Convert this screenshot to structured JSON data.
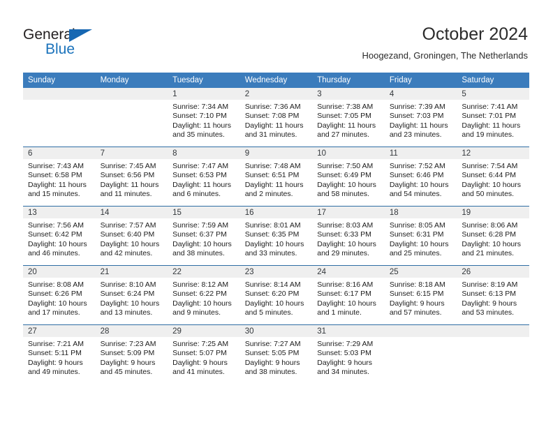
{
  "brand": {
    "name_part1": "General",
    "name_part2": "Blue",
    "triangle_color": "#1667b2",
    "blue_color": "#1a72bb"
  },
  "header": {
    "title": "October 2024",
    "subtitle": "Hoogezand, Groningen, The Netherlands"
  },
  "theme": {
    "header_row_bg": "#3b7cbc",
    "row_divider": "#2e6da4",
    "daynum_bg": "#efefef"
  },
  "weekdays": [
    "Sunday",
    "Monday",
    "Tuesday",
    "Wednesday",
    "Thursday",
    "Friday",
    "Saturday"
  ],
  "weeks": [
    [
      {
        "day": "",
        "empty": true,
        "sunrise": "",
        "sunset": "",
        "daylight_line1": "",
        "daylight_line2": ""
      },
      {
        "day": "",
        "empty": true,
        "sunrise": "",
        "sunset": "",
        "daylight_line1": "",
        "daylight_line2": ""
      },
      {
        "day": "1",
        "sunrise": "Sunrise: 7:34 AM",
        "sunset": "Sunset: 7:10 PM",
        "daylight_line1": "Daylight: 11 hours",
        "daylight_line2": "and 35 minutes."
      },
      {
        "day": "2",
        "sunrise": "Sunrise: 7:36 AM",
        "sunset": "Sunset: 7:08 PM",
        "daylight_line1": "Daylight: 11 hours",
        "daylight_line2": "and 31 minutes."
      },
      {
        "day": "3",
        "sunrise": "Sunrise: 7:38 AM",
        "sunset": "Sunset: 7:05 PM",
        "daylight_line1": "Daylight: 11 hours",
        "daylight_line2": "and 27 minutes."
      },
      {
        "day": "4",
        "sunrise": "Sunrise: 7:39 AM",
        "sunset": "Sunset: 7:03 PM",
        "daylight_line1": "Daylight: 11 hours",
        "daylight_line2": "and 23 minutes."
      },
      {
        "day": "5",
        "sunrise": "Sunrise: 7:41 AM",
        "sunset": "Sunset: 7:01 PM",
        "daylight_line1": "Daylight: 11 hours",
        "daylight_line2": "and 19 minutes."
      }
    ],
    [
      {
        "day": "6",
        "sunrise": "Sunrise: 7:43 AM",
        "sunset": "Sunset: 6:58 PM",
        "daylight_line1": "Daylight: 11 hours",
        "daylight_line2": "and 15 minutes."
      },
      {
        "day": "7",
        "sunrise": "Sunrise: 7:45 AM",
        "sunset": "Sunset: 6:56 PM",
        "daylight_line1": "Daylight: 11 hours",
        "daylight_line2": "and 11 minutes."
      },
      {
        "day": "8",
        "sunrise": "Sunrise: 7:47 AM",
        "sunset": "Sunset: 6:53 PM",
        "daylight_line1": "Daylight: 11 hours",
        "daylight_line2": "and 6 minutes."
      },
      {
        "day": "9",
        "sunrise": "Sunrise: 7:48 AM",
        "sunset": "Sunset: 6:51 PM",
        "daylight_line1": "Daylight: 11 hours",
        "daylight_line2": "and 2 minutes."
      },
      {
        "day": "10",
        "sunrise": "Sunrise: 7:50 AM",
        "sunset": "Sunset: 6:49 PM",
        "daylight_line1": "Daylight: 10 hours",
        "daylight_line2": "and 58 minutes."
      },
      {
        "day": "11",
        "sunrise": "Sunrise: 7:52 AM",
        "sunset": "Sunset: 6:46 PM",
        "daylight_line1": "Daylight: 10 hours",
        "daylight_line2": "and 54 minutes."
      },
      {
        "day": "12",
        "sunrise": "Sunrise: 7:54 AM",
        "sunset": "Sunset: 6:44 PM",
        "daylight_line1": "Daylight: 10 hours",
        "daylight_line2": "and 50 minutes."
      }
    ],
    [
      {
        "day": "13",
        "sunrise": "Sunrise: 7:56 AM",
        "sunset": "Sunset: 6:42 PM",
        "daylight_line1": "Daylight: 10 hours",
        "daylight_line2": "and 46 minutes."
      },
      {
        "day": "14",
        "sunrise": "Sunrise: 7:57 AM",
        "sunset": "Sunset: 6:40 PM",
        "daylight_line1": "Daylight: 10 hours",
        "daylight_line2": "and 42 minutes."
      },
      {
        "day": "15",
        "sunrise": "Sunrise: 7:59 AM",
        "sunset": "Sunset: 6:37 PM",
        "daylight_line1": "Daylight: 10 hours",
        "daylight_line2": "and 38 minutes."
      },
      {
        "day": "16",
        "sunrise": "Sunrise: 8:01 AM",
        "sunset": "Sunset: 6:35 PM",
        "daylight_line1": "Daylight: 10 hours",
        "daylight_line2": "and 33 minutes."
      },
      {
        "day": "17",
        "sunrise": "Sunrise: 8:03 AM",
        "sunset": "Sunset: 6:33 PM",
        "daylight_line1": "Daylight: 10 hours",
        "daylight_line2": "and 29 minutes."
      },
      {
        "day": "18",
        "sunrise": "Sunrise: 8:05 AM",
        "sunset": "Sunset: 6:31 PM",
        "daylight_line1": "Daylight: 10 hours",
        "daylight_line2": "and 25 minutes."
      },
      {
        "day": "19",
        "sunrise": "Sunrise: 8:06 AM",
        "sunset": "Sunset: 6:28 PM",
        "daylight_line1": "Daylight: 10 hours",
        "daylight_line2": "and 21 minutes."
      }
    ],
    [
      {
        "day": "20",
        "sunrise": "Sunrise: 8:08 AM",
        "sunset": "Sunset: 6:26 PM",
        "daylight_line1": "Daylight: 10 hours",
        "daylight_line2": "and 17 minutes."
      },
      {
        "day": "21",
        "sunrise": "Sunrise: 8:10 AM",
        "sunset": "Sunset: 6:24 PM",
        "daylight_line1": "Daylight: 10 hours",
        "daylight_line2": "and 13 minutes."
      },
      {
        "day": "22",
        "sunrise": "Sunrise: 8:12 AM",
        "sunset": "Sunset: 6:22 PM",
        "daylight_line1": "Daylight: 10 hours",
        "daylight_line2": "and 9 minutes."
      },
      {
        "day": "23",
        "sunrise": "Sunrise: 8:14 AM",
        "sunset": "Sunset: 6:20 PM",
        "daylight_line1": "Daylight: 10 hours",
        "daylight_line2": "and 5 minutes."
      },
      {
        "day": "24",
        "sunrise": "Sunrise: 8:16 AM",
        "sunset": "Sunset: 6:17 PM",
        "daylight_line1": "Daylight: 10 hours",
        "daylight_line2": "and 1 minute."
      },
      {
        "day": "25",
        "sunrise": "Sunrise: 8:18 AM",
        "sunset": "Sunset: 6:15 PM",
        "daylight_line1": "Daylight: 9 hours",
        "daylight_line2": "and 57 minutes."
      },
      {
        "day": "26",
        "sunrise": "Sunrise: 8:19 AM",
        "sunset": "Sunset: 6:13 PM",
        "daylight_line1": "Daylight: 9 hours",
        "daylight_line2": "and 53 minutes."
      }
    ],
    [
      {
        "day": "27",
        "sunrise": "Sunrise: 7:21 AM",
        "sunset": "Sunset: 5:11 PM",
        "daylight_line1": "Daylight: 9 hours",
        "daylight_line2": "and 49 minutes."
      },
      {
        "day": "28",
        "sunrise": "Sunrise: 7:23 AM",
        "sunset": "Sunset: 5:09 PM",
        "daylight_line1": "Daylight: 9 hours",
        "daylight_line2": "and 45 minutes."
      },
      {
        "day": "29",
        "sunrise": "Sunrise: 7:25 AM",
        "sunset": "Sunset: 5:07 PM",
        "daylight_line1": "Daylight: 9 hours",
        "daylight_line2": "and 41 minutes."
      },
      {
        "day": "30",
        "sunrise": "Sunrise: 7:27 AM",
        "sunset": "Sunset: 5:05 PM",
        "daylight_line1": "Daylight: 9 hours",
        "daylight_line2": "and 38 minutes."
      },
      {
        "day": "31",
        "sunrise": "Sunrise: 7:29 AM",
        "sunset": "Sunset: 5:03 PM",
        "daylight_line1": "Daylight: 9 hours",
        "daylight_line2": "and 34 minutes."
      },
      {
        "day": "",
        "empty": true,
        "sunrise": "",
        "sunset": "",
        "daylight_line1": "",
        "daylight_line2": ""
      },
      {
        "day": "",
        "empty": true,
        "sunrise": "",
        "sunset": "",
        "daylight_line1": "",
        "daylight_line2": ""
      }
    ]
  ]
}
